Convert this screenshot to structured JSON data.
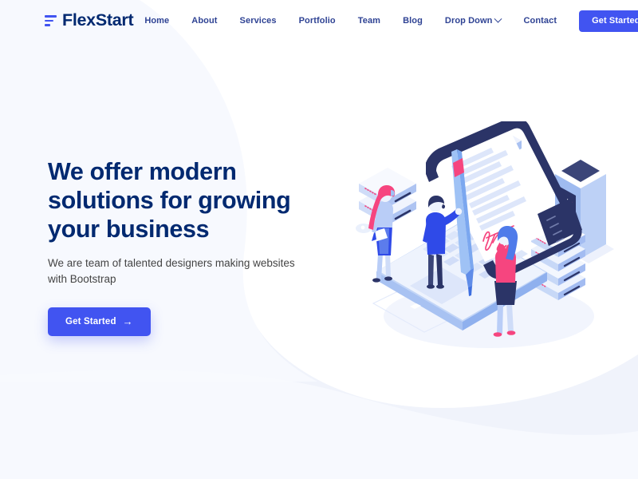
{
  "brand": {
    "name": "FlexStart",
    "logo_icon": "three-bars-icon",
    "accent_color": "#4154f1",
    "navy_color": "#012970"
  },
  "header": {
    "nav_items": [
      {
        "label": "Home",
        "icon": null,
        "active": true
      },
      {
        "label": "About",
        "icon": null,
        "active": false
      },
      {
        "label": "Services",
        "icon": null,
        "active": false
      },
      {
        "label": "Portfolio",
        "icon": null,
        "active": false
      },
      {
        "label": "Team",
        "icon": null,
        "active": false
      },
      {
        "label": "Blog",
        "icon": null,
        "active": false
      },
      {
        "label": "Drop Down",
        "icon": "chevron-down-icon",
        "active": false
      },
      {
        "label": "Contact",
        "icon": null,
        "active": false
      }
    ],
    "cta_label": "Get Started"
  },
  "hero": {
    "title_line1": "We offer modern",
    "title_line2": "solutions for growing",
    "title_line3": "your business",
    "subtitle": "We are team of talented designers making websites with Bootstrap",
    "cta_label": "Get Started",
    "cta_icon": "arrow-right-icon",
    "illustration": {
      "name": "isometric-digital-signature-illustration",
      "elements": [
        "laptop",
        "document-on-screen",
        "pink-signature",
        "giant-pen",
        "man-signing",
        "woman-with-paper",
        "woman-with-phone",
        "server-tower",
        "server-stack-left",
        "server-stack-right",
        "router-device"
      ]
    }
  },
  "colors": {
    "page_bg": "#ffffff",
    "curve_bg": "#f0f3fb",
    "curve_bg_soft": "#f7f9fe",
    "text_body": "#444444",
    "nav_text": "#2f4394",
    "illus_blue": "#4154f1",
    "illus_navy": "#2b3467",
    "illus_light": "#e8eefc",
    "illus_pink": "#f6457f"
  }
}
